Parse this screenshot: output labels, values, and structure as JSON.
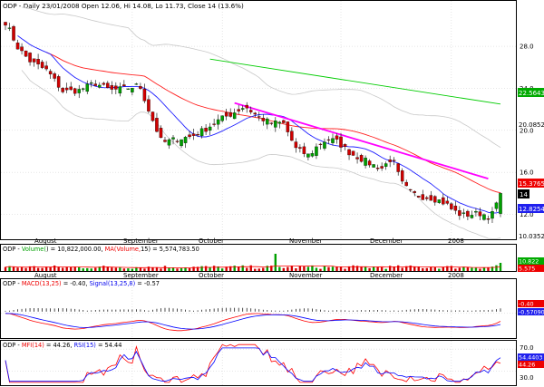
{
  "colors": {
    "up": "#00a000",
    "down": "#d00000",
    "ma_long": "#00cc00",
    "ma_mid": "#ff2020",
    "ma_short": "#2020ff",
    "band": "#c8c8c8",
    "trend": "#ff00ff",
    "macd": "#ff0000",
    "signal": "#0000ff",
    "mfi": "#ff0000",
    "rsi": "#0000ff"
  },
  "panels": {
    "price": {
      "title": "ODP - Daily 23/01/2008 Open 12.06, Hi 14.08, Lo 11.73, Close 14 (13.6%)"
    },
    "volume": {
      "title_prefix": "ODP - ",
      "vol_label": "Volume(",
      "vol_arg": ") = 10,822,000.00, ",
      "ma_label": "MA(Volume,",
      "ma_arg": "15",
      "ma_value": ") = 5,574,783.50"
    },
    "macd": {
      "title_prefix": "ODP - ",
      "macd_label": "MACD(13,25)",
      "macd_value": " = -0.40, ",
      "signal_label": "Signal(13,25,8)",
      "signal_value": " = -0.57"
    },
    "mfi": {
      "title_prefix": "ODP - ",
      "mfi_label": "MFI(14)",
      "mfi_value": " = 44.26, ",
      "rsi_label": "RSI(15)",
      "rsi_value": " = 54.44"
    }
  },
  "chart_data": {
    "type": "candlestick",
    "title": "ODP - Daily 23/01/2008 Open 12.06, Hi 14.08, Lo 11.73, Close 14 (13.6%)",
    "months": [
      "August",
      "September",
      "October",
      "November",
      "December",
      "2008"
    ],
    "price_axis": {
      "ticks": [
        "28.0",
        "24.0",
        "20.0",
        "16.0",
        "12.0"
      ],
      "tick_values": [
        28,
        24,
        20,
        16,
        12
      ],
      "range": [
        9.8,
        31.2
      ]
    },
    "price_labels": {
      "ma_long": "22.5643",
      "ma_mid_band": "20.0852",
      "ma_mid": "15.3765",
      "last": "14",
      "ma_short": "12.8254",
      "band_low": "10.0352"
    },
    "volume_labels": {
      "volume": "10.822",
      "ma": "5.575"
    },
    "macd_labels": {
      "macd": "-0.40",
      "signal": "-0.57090"
    },
    "mfi_axis": {
      "ticks": [
        "70.0",
        "30.0"
      ]
    },
    "mfi_labels": {
      "rsi": "54.4403",
      "mfi": "44.26"
    },
    "macd_range": [
      -3.2,
      3.4
    ],
    "osc_range": [
      5,
      80
    ]
  }
}
